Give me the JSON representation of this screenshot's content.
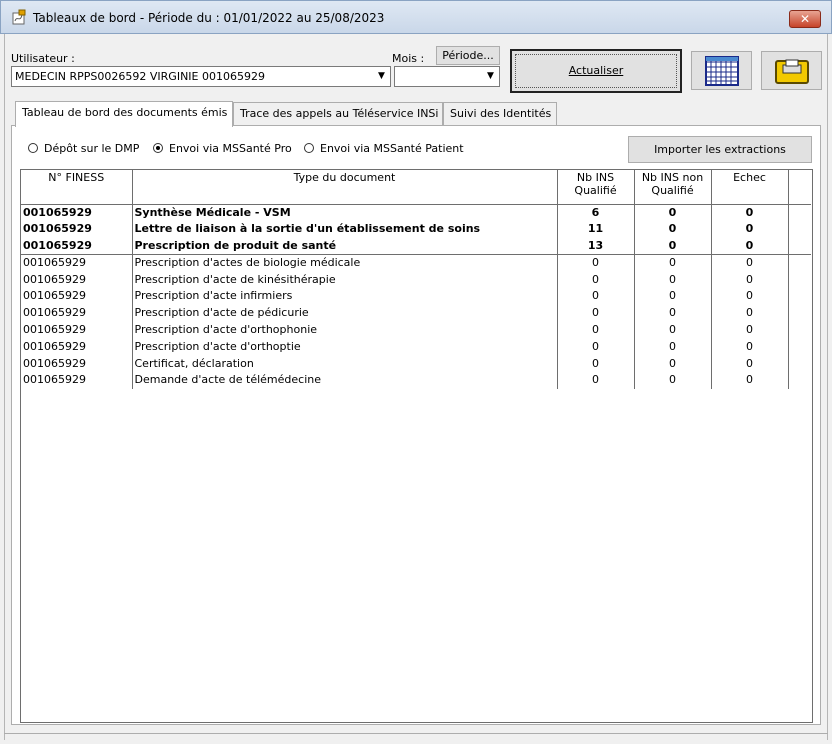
{
  "window": {
    "title": "Tableaux de bord - Période du : 01/01/2022 au 25/08/2023",
    "close_label": "✕"
  },
  "filters": {
    "user_label": "Utilisateur :",
    "user_value": "MEDECIN RPPS0026592 VIRGINIE 001065929",
    "month_label": "Mois :",
    "month_value": "",
    "period_button": "Période...",
    "refresh_button": "Actualiser"
  },
  "tabs": [
    {
      "label": "Tableau de bord des documents émis",
      "active": true
    },
    {
      "label": "Trace des appels au Téléservice INSi",
      "active": false
    },
    {
      "label": "Suivi des Identités",
      "active": false
    }
  ],
  "radios": [
    {
      "label": "Dépôt sur le DMP",
      "checked": false
    },
    {
      "label": "Envoi via MSSanté Pro",
      "checked": true
    },
    {
      "label": "Envoi via MSSanté Patient",
      "checked": false
    }
  ],
  "import_button": "Importer les extractions",
  "table": {
    "columns": [
      "N° FINESS",
      "Type du document",
      "Nb INS Qualifié",
      "Nb INS non Qualifié",
      "Echec"
    ],
    "rows": [
      {
        "finess": "001065929",
        "type": "Synthèse Médicale - VSM",
        "q": "6",
        "nq": "0",
        "echec": "0",
        "bold": true
      },
      {
        "finess": "001065929",
        "type": "Lettre de liaison à la sortie d'un établissement de soins",
        "q": "11",
        "nq": "0",
        "echec": "0",
        "bold": true
      },
      {
        "finess": "001065929",
        "type": "Prescription de produit de santé",
        "q": "13",
        "nq": "0",
        "echec": "0",
        "bold": true
      },
      {
        "finess": "001065929",
        "type": "Prescription d'actes de biologie médicale",
        "q": "0",
        "nq": "0",
        "echec": "0",
        "bold": false
      },
      {
        "finess": "001065929",
        "type": "Prescription d'acte de kinésithérapie",
        "q": "0",
        "nq": "0",
        "echec": "0",
        "bold": false
      },
      {
        "finess": "001065929",
        "type": "Prescription d'acte infirmiers",
        "q": "0",
        "nq": "0",
        "echec": "0",
        "bold": false
      },
      {
        "finess": "001065929",
        "type": "Prescription d'acte de pédicurie",
        "q": "0",
        "nq": "0",
        "echec": "0",
        "bold": false
      },
      {
        "finess": "001065929",
        "type": "Prescription d'acte d'orthophonie",
        "q": "0",
        "nq": "0",
        "echec": "0",
        "bold": false
      },
      {
        "finess": "001065929",
        "type": "Prescription d'acte d'orthoptie",
        "q": "0",
        "nq": "0",
        "echec": "0",
        "bold": false
      },
      {
        "finess": "001065929",
        "type": "Certificat, déclaration",
        "q": "0",
        "nq": "0",
        "echec": "0",
        "bold": false
      },
      {
        "finess": "001065929",
        "type": "Demande d'acte de télémédecine",
        "q": "0",
        "nq": "0",
        "echec": "0",
        "bold": false
      }
    ]
  },
  "colors": {
    "titlebar": "#c9d7e9",
    "close": "#c6442a",
    "grid_border": "#6e6e6e"
  },
  "icons": {
    "app": "app-icon",
    "grid_button": "grid-icon",
    "folder_button": "folder-icon"
  }
}
